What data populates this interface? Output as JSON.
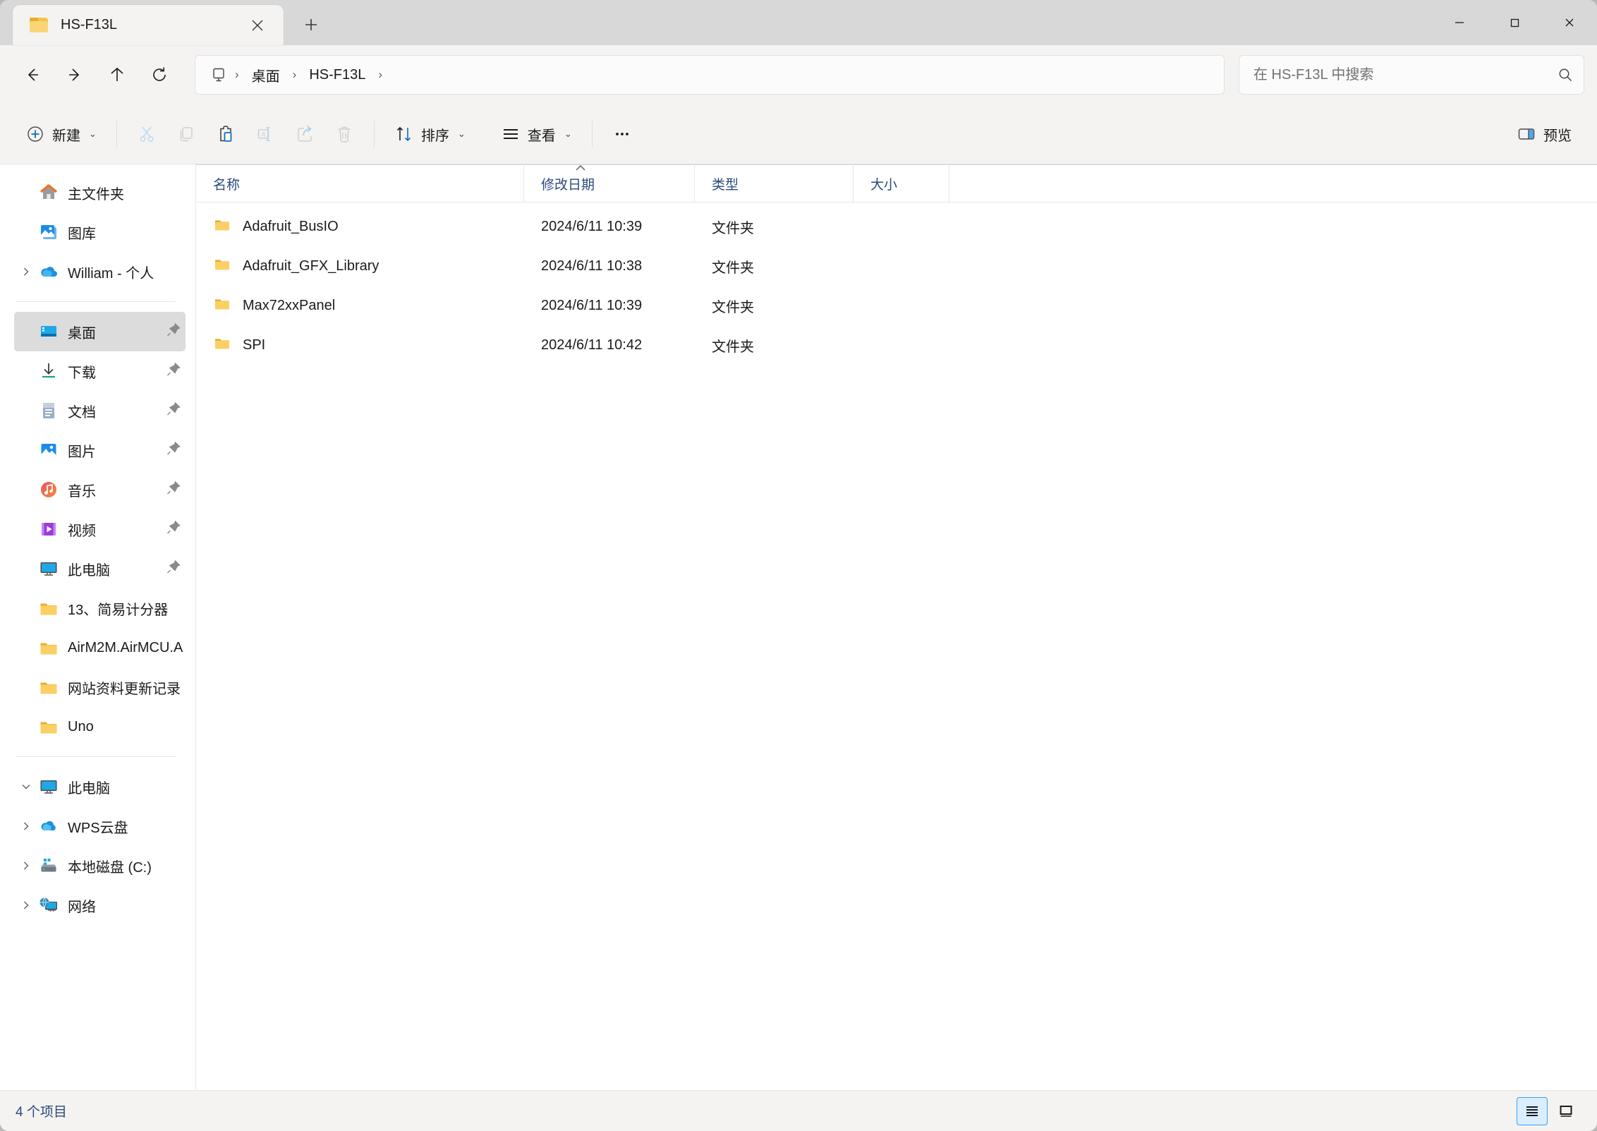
{
  "window": {
    "tab_title": "HS-F13L",
    "minimize_label": "最小化",
    "maximize_label": "最大化",
    "close_label": "关闭",
    "new_tab_label": "新建标签页"
  },
  "nav": {
    "back_label": "返回",
    "forward_label": "前进",
    "up_label": "向上",
    "refresh_label": "刷新",
    "breadcrumb": [
      "桌面",
      "HS-F13L"
    ],
    "separator": "›"
  },
  "search": {
    "placeholder": "在 HS-F13L 中搜索",
    "value": ""
  },
  "toolbar": {
    "new_label": "新建",
    "cut_label": "剪切",
    "copy_label": "复制",
    "paste_label": "粘贴",
    "rename_label": "重命名",
    "share_label": "共享",
    "delete_label": "删除",
    "sort_label": "排序",
    "view_label": "查看",
    "more_label": "···",
    "preview_label": "预览",
    "chevron": "⌄"
  },
  "sidebar": {
    "groups": [
      {
        "items": [
          {
            "label": "主文件夹",
            "icon": "home-icon",
            "chevron": false,
            "pinned": false,
            "selected": false
          },
          {
            "label": "图库",
            "icon": "gallery-icon",
            "chevron": false,
            "pinned": false,
            "selected": false
          },
          {
            "label": "William - 个人",
            "icon": "onedrive-icon",
            "chevron": true,
            "pinned": false,
            "selected": false
          }
        ]
      },
      {
        "items": [
          {
            "label": "桌面",
            "icon": "desktop-icon",
            "chevron": false,
            "pinned": true,
            "selected": true
          },
          {
            "label": "下载",
            "icon": "downloads-icon",
            "chevron": false,
            "pinned": true,
            "selected": false
          },
          {
            "label": "文档",
            "icon": "documents-icon",
            "chevron": false,
            "pinned": true,
            "selected": false
          },
          {
            "label": "图片",
            "icon": "pictures-icon",
            "chevron": false,
            "pinned": true,
            "selected": false
          },
          {
            "label": "音乐",
            "icon": "music-icon",
            "chevron": false,
            "pinned": true,
            "selected": false
          },
          {
            "label": "视频",
            "icon": "videos-icon",
            "chevron": false,
            "pinned": true,
            "selected": false
          },
          {
            "label": "此电脑",
            "icon": "thispc-icon",
            "chevron": false,
            "pinned": true,
            "selected": false
          },
          {
            "label": "13、简易计分器",
            "icon": "folder-icon",
            "chevron": false,
            "pinned": false,
            "selected": false
          },
          {
            "label": "AirM2M.AirMCU.A",
            "icon": "folder-icon",
            "chevron": false,
            "pinned": false,
            "selected": false
          },
          {
            "label": "网站资料更新记录",
            "icon": "folder-icon",
            "chevron": false,
            "pinned": false,
            "selected": false
          },
          {
            "label": "Uno",
            "icon": "folder-icon",
            "chevron": false,
            "pinned": false,
            "selected": false
          }
        ]
      },
      {
        "items": [
          {
            "label": "此电脑",
            "icon": "thispc-icon",
            "chevron": true,
            "expanded": true,
            "pinned": false,
            "selected": false
          },
          {
            "label": "WPS云盘",
            "icon": "wpscloud-icon",
            "chevron": true,
            "indent": true,
            "pinned": false,
            "selected": false
          },
          {
            "label": "本地磁盘 (C:)",
            "icon": "drive-icon",
            "chevron": true,
            "indent": true,
            "pinned": false,
            "selected": false
          },
          {
            "label": "网络",
            "icon": "network-icon",
            "chevron": true,
            "pinned": false,
            "selected": false
          }
        ]
      }
    ]
  },
  "filelist": {
    "columns": [
      "名称",
      "修改日期",
      "类型",
      "大小"
    ],
    "sort_column": "名称",
    "sort_direction": "ascending",
    "rows": [
      {
        "name": "Adafruit_BusIO",
        "date": "2024/6/11 10:39",
        "type": "文件夹",
        "size": ""
      },
      {
        "name": "Adafruit_GFX_Library",
        "date": "2024/6/11 10:38",
        "type": "文件夹",
        "size": ""
      },
      {
        "name": "Max72xxPanel",
        "date": "2024/6/11 10:39",
        "type": "文件夹",
        "size": ""
      },
      {
        "name": "SPI",
        "date": "2024/6/11 10:42",
        "type": "文件夹",
        "size": ""
      }
    ]
  },
  "statusbar": {
    "item_count": "4 个项目",
    "details_view_label": "详细信息",
    "tiles_view_label": "大图标"
  },
  "colors": {
    "accent": "#0f6cbd",
    "folder": "#fbcf63",
    "folder_tab": "#e8ae2b",
    "header_text": "#2a4a7a",
    "selected_row": "#dcdcdc",
    "titlebar": "#d8d8d8",
    "chrome": "#f4f3f2"
  }
}
